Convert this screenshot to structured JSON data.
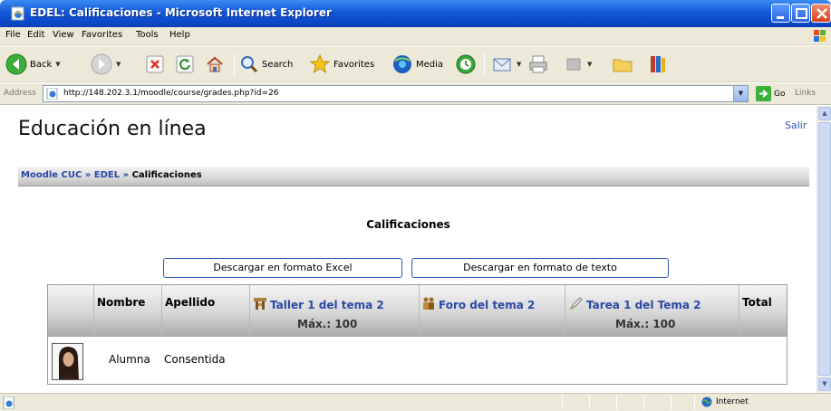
{
  "window": {
    "title": "EDEL: Calificaciones - Microsoft Internet Explorer"
  },
  "menubar": {
    "items": [
      "File",
      "Edit",
      "View",
      "Favorites",
      "Tools",
      "Help"
    ]
  },
  "toolbar": {
    "back_label": "Back",
    "search_label": "Search",
    "favorites_label": "Favorites",
    "media_label": "Media"
  },
  "addressbar": {
    "label": "Address",
    "url": "http://148.202.3.1/moodle/course/grades.php?id=26",
    "go_label": "Go",
    "links_label": "Links"
  },
  "page": {
    "site_title": "Educación en línea",
    "logout": "Salir",
    "breadcrumb": {
      "home": "Moodle CUC",
      "separator": "»",
      "course": "EDEL",
      "current": "Calificaciones"
    },
    "heading": "Calificaciones",
    "download_excel": "Descargar en formato Excel",
    "download_text": "Descargar en formato de texto",
    "grades_table": {
      "headers": {
        "name": "Nombre",
        "surname": "Apellido",
        "activities": [
          {
            "label": "Taller 1 del tema 2",
            "max": "Máx.: 100",
            "icon": "workshop-icon"
          },
          {
            "label": "Foro del tema 2",
            "max": "",
            "icon": "forum-icon"
          },
          {
            "label": "Tarea 1 del Tema 2",
            "max": "Máx.: 100",
            "icon": "assignment-icon"
          }
        ],
        "total": "Total"
      },
      "rows": [
        {
          "name": "Alumna",
          "surname": "Consentida"
        }
      ]
    }
  },
  "statusbar": {
    "zone": "Internet"
  },
  "colors": {
    "titlebar": "#0a46c4",
    "link": "#2b49a6",
    "chrome": "#ece9d8"
  }
}
